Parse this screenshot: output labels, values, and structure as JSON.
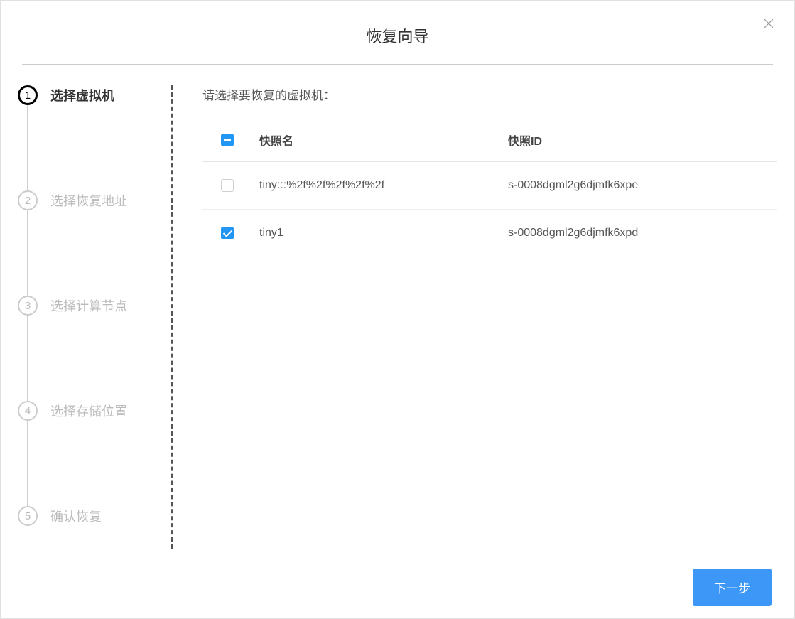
{
  "dialog": {
    "title": "恢复向导"
  },
  "stepper": {
    "steps": [
      {
        "num": "1",
        "label": "选择虚拟机",
        "active": true
      },
      {
        "num": "2",
        "label": "选择恢复地址",
        "active": false
      },
      {
        "num": "3",
        "label": "选择计算节点",
        "active": false
      },
      {
        "num": "4",
        "label": "选择存储位置",
        "active": false
      },
      {
        "num": "5",
        "label": "确认恢复",
        "active": false
      }
    ]
  },
  "main": {
    "instruction": "请选择要恢复的虚拟机：",
    "table": {
      "header_check_state": "indeterminate",
      "columns": {
        "snapshot_name": "快照名",
        "snapshot_id": "快照ID"
      },
      "rows": [
        {
          "checked": false,
          "name": "tiny:::%2f%2f%2f%2f%2f",
          "id": "s-0008dgml2g6djmfk6xpe"
        },
        {
          "checked": true,
          "name": "tiny1",
          "id": "s-0008dgml2g6djmfk6xpd"
        }
      ]
    }
  },
  "footer": {
    "next_button": "下一步"
  }
}
